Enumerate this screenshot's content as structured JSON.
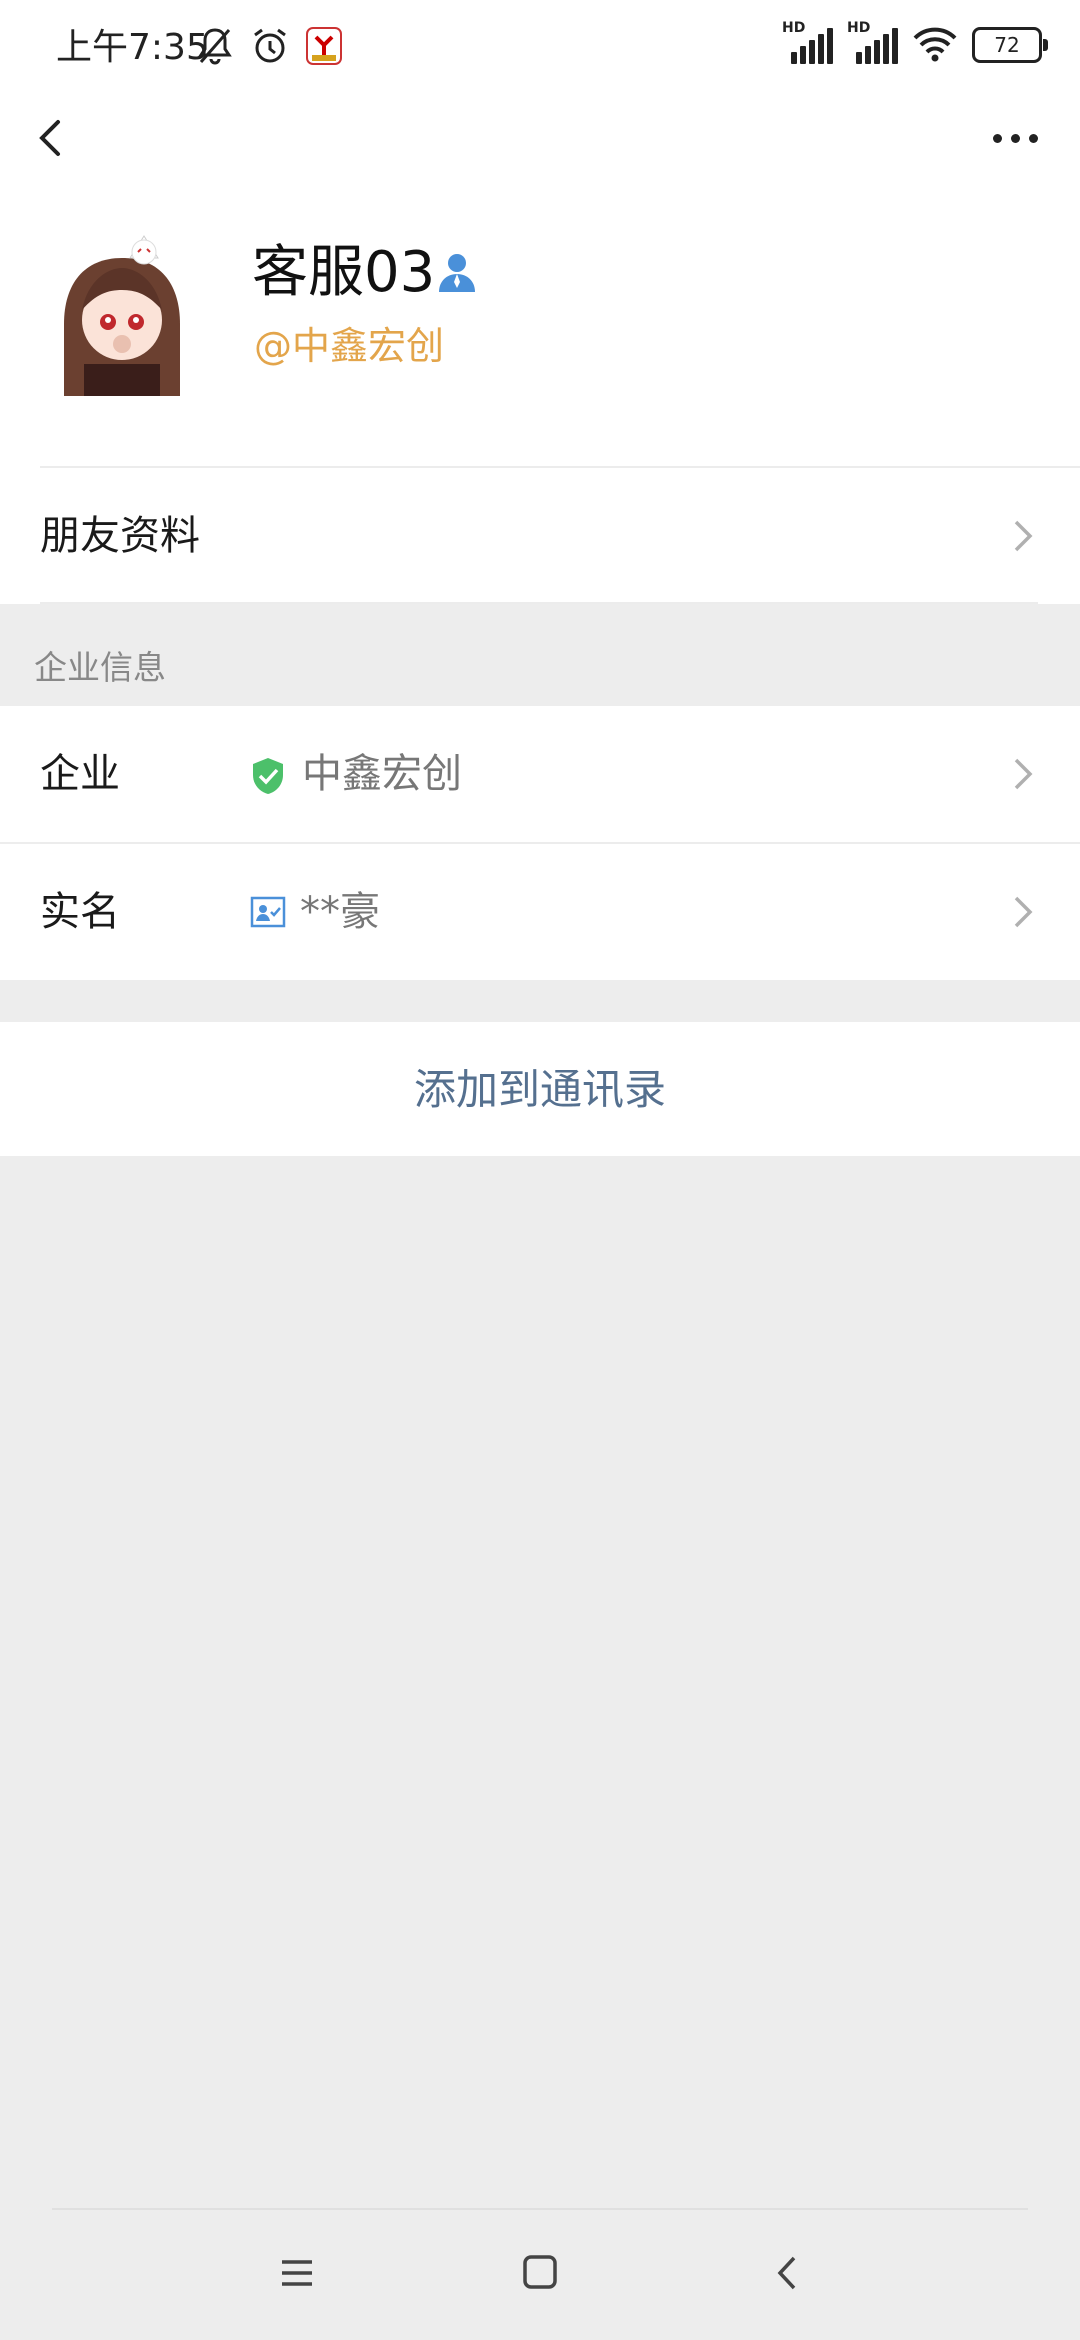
{
  "status_bar": {
    "time": "上午7:35",
    "hd1": "HD",
    "hd2": "HD",
    "battery": "72"
  },
  "profile": {
    "name": "客服03",
    "corp_tag": "@中鑫宏创"
  },
  "menu": {
    "friend_profile": "朋友资料"
  },
  "enterprise_section": {
    "title": "企业信息",
    "company_label": "企业",
    "company_value": "中鑫宏创",
    "realname_label": "实名",
    "realname_value": "**豪"
  },
  "actions": {
    "add_contact": "添加到通讯录"
  },
  "colors": {
    "accent_orange": "#e3a54b",
    "link_blue": "#55708f",
    "verified_green": "#4cc06a",
    "contact_blue": "#4a90d9"
  },
  "icons": [
    "back-icon",
    "more-icon",
    "contact-person-icon",
    "verified-shield-icon",
    "id-card-icon",
    "chevron-right-icon",
    "menu-icon",
    "home-icon",
    "nav-back-icon"
  ]
}
